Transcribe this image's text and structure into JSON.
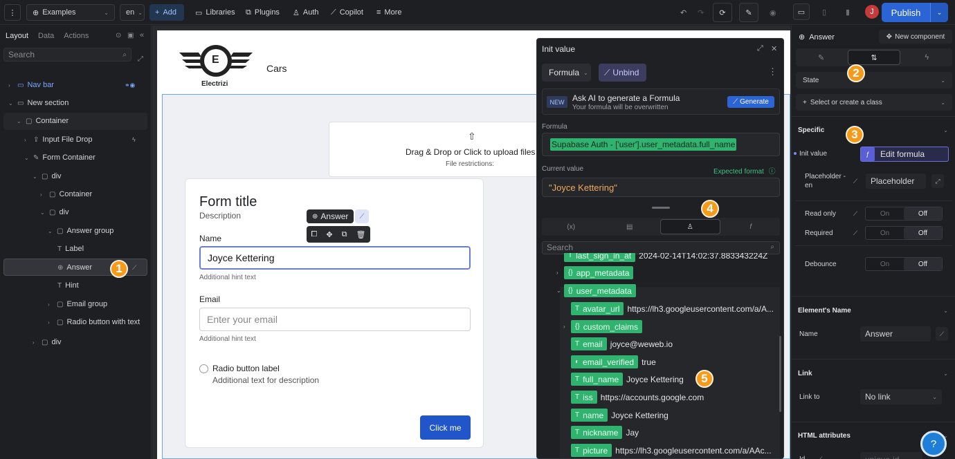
{
  "topbar": {
    "project": "Examples",
    "lang": "en",
    "add": "Add",
    "libraries": "Libraries",
    "plugins": "Plugins",
    "auth": "Auth",
    "copilot": "Copilot",
    "more": "More",
    "avatar": "J",
    "publish": "Publish"
  },
  "left": {
    "tabs": [
      "Layout",
      "Data",
      "Actions"
    ],
    "search_placeholder": "Search",
    "tree": [
      {
        "label": "Nav bar"
      },
      {
        "label": "New section"
      },
      {
        "label": "Container"
      },
      {
        "label": "Input File Drop"
      },
      {
        "label": "Form Container"
      },
      {
        "label": "div"
      },
      {
        "label": "Container"
      },
      {
        "label": "div"
      },
      {
        "label": "Answer group"
      },
      {
        "label": "Label"
      },
      {
        "label": "Answer"
      },
      {
        "label": "Hint"
      },
      {
        "label": "Email group"
      },
      {
        "label": "Radio button with text"
      },
      {
        "label": "div"
      }
    ]
  },
  "canvas": {
    "logo_letter": "E",
    "logo_text": "Electrizi",
    "nav_text": "Cars",
    "drop_title": "Drag & Drop or Click to upload files",
    "drop_sub": "File restrictions:",
    "form_title": "Form title",
    "form_desc": "Description",
    "name_label": "Name",
    "name_value": "Joyce Kettering",
    "name_hint": "Additional hint text",
    "email_label": "Email",
    "email_placeholder": "Enter your email",
    "email_hint": "Additional hint text",
    "radio_label": "Radio button label",
    "radio_sub": "Additional text for description",
    "click_me": "Click me",
    "tag_answer": "Answer"
  },
  "popup": {
    "title": "Init value",
    "formula_btn": "Formula",
    "unbind_btn": "Unbind",
    "ai_badge": "NEW",
    "ai_title": "Ask AI to generate a Formula",
    "ai_sub": "Your formula will be overwritten",
    "generate": "Generate",
    "formula_label": "Formula",
    "formula_value": "Supabase Auth - ['user'].user_metadata.full_name",
    "current_label": "Current value",
    "expected": "Expected format",
    "current_value": "\"Joyce Kettering\"",
    "tab_icons": [
      "(x)",
      "db",
      "user",
      "f"
    ],
    "search_placeholder": "Search",
    "tree": {
      "last_sign_in_at": "last_sign_in_at",
      "last_sign_in_val": "2024-02-14T14:02:37.883343224Z",
      "app_metadata": "app_metadata",
      "user_metadata": "user_metadata",
      "items": [
        {
          "key": "avatar_url",
          "value": "https://lh3.googleusercontent.com/a/A..."
        },
        {
          "key": "custom_claims",
          "value": ""
        },
        {
          "key": "email",
          "value": "joyce@weweb.io"
        },
        {
          "key": "email_verified",
          "value": "true"
        },
        {
          "key": "full_name",
          "value": "Joyce Kettering"
        },
        {
          "key": "iss",
          "value": "https://accounts.google.com"
        },
        {
          "key": "name",
          "value": "Joyce Kettering"
        },
        {
          "key": "nickname",
          "value": "Jay"
        },
        {
          "key": "picture",
          "value": "https://lh3.googleusercontent.com/a/AAc..."
        }
      ]
    }
  },
  "right": {
    "element": "Answer",
    "new_component": "New component",
    "state": "State",
    "class_select": "Select or create a class",
    "specific": "Specific",
    "init_value": "Init value",
    "edit_formula": "Edit formula",
    "placeholder_label": "Placeholder - en",
    "placeholder_value": "Placeholder",
    "read_only": "Read only",
    "required": "Required",
    "debounce": "Debounce",
    "on": "On",
    "off": "Off",
    "element_name_section": "Element's Name",
    "name_label": "Name",
    "name_value": "Answer",
    "link_section": "Link",
    "link_to": "Link to",
    "no_link": "No link",
    "html_attr": "HTML attributes",
    "id_label": "Id",
    "id_placeholder": "unique-id"
  },
  "badges": [
    "1",
    "2",
    "3",
    "4",
    "5"
  ]
}
